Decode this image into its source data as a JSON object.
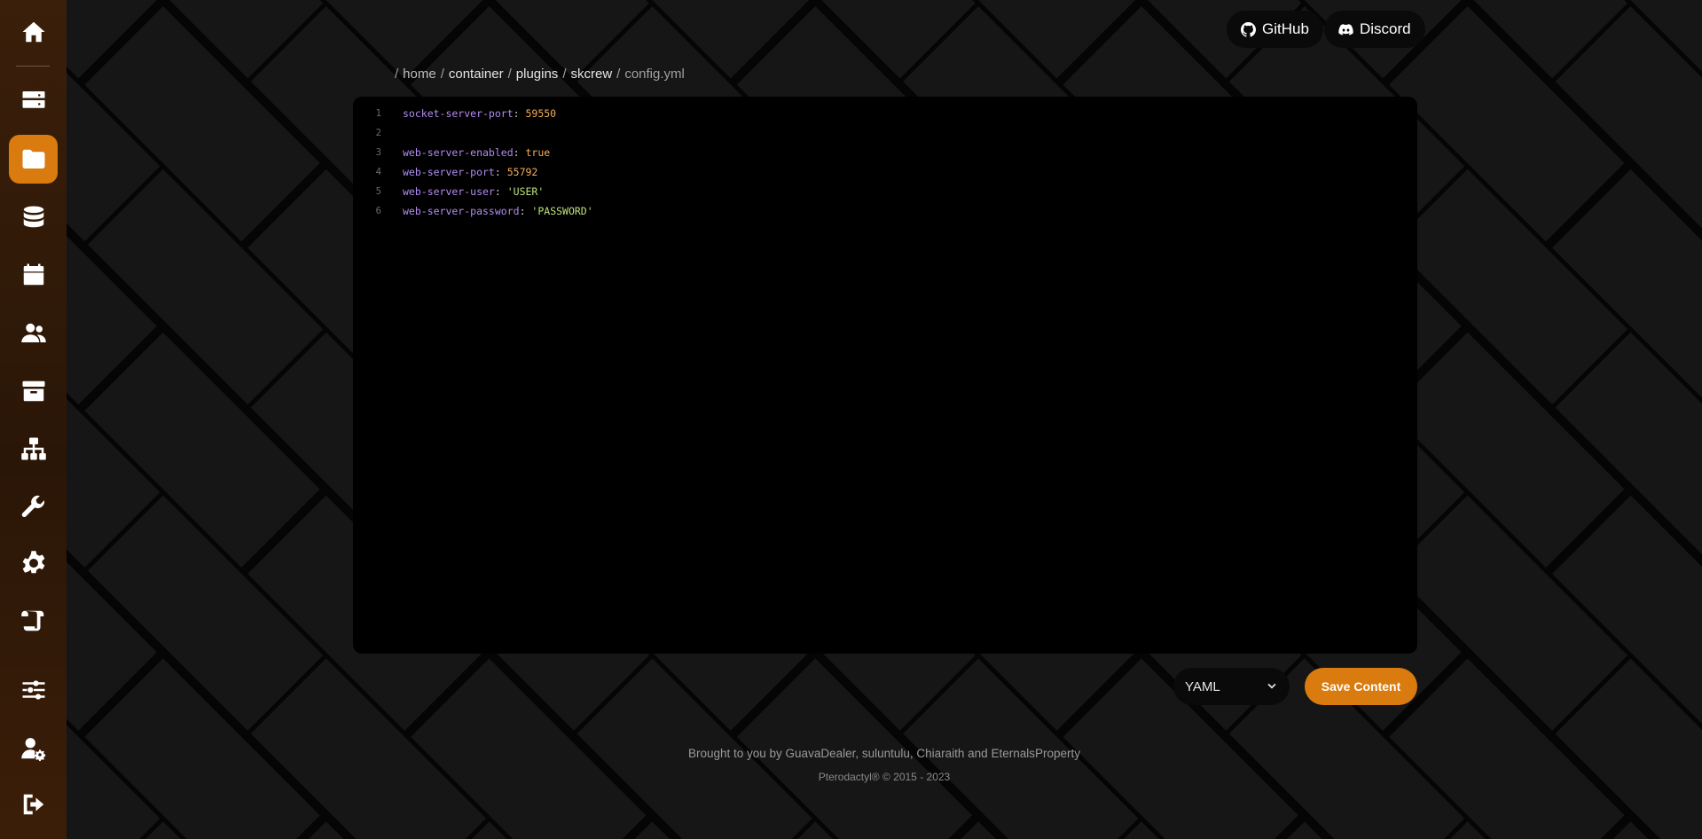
{
  "top_links": {
    "github_label": "GitHub",
    "discord_label": "Discord"
  },
  "breadcrumb": {
    "root_sep": "/",
    "parts": [
      "home",
      "container",
      "plugins",
      "skcrew"
    ],
    "current": "config.yml"
  },
  "editor": {
    "lines": [
      {
        "num": "1",
        "key": "socket-server-port",
        "value": "59550",
        "type": "number"
      },
      {
        "num": "2",
        "key": "",
        "value": "",
        "type": "empty"
      },
      {
        "num": "3",
        "key": "web-server-enabled",
        "value": "true",
        "type": "bool"
      },
      {
        "num": "4",
        "key": "web-server-port",
        "value": "55792",
        "type": "number"
      },
      {
        "num": "5",
        "key": "web-server-user",
        "value": "'USER'",
        "type": "string"
      },
      {
        "num": "6",
        "key": "web-server-password",
        "value": "'PASSWORD'",
        "type": "string"
      }
    ]
  },
  "controls": {
    "language_selected": "YAML",
    "save_label": "Save Content"
  },
  "footer": {
    "credits": "Brought to you by GuavaDealer, suluntulu, Chiaraith and EternalsProperty",
    "copyright": "Pterodactyl® © 2015 - 2023"
  },
  "colors": {
    "accent": "#d97b0e",
    "sidebar": "#2a1607",
    "background": "#161616",
    "editor_bg": "#000000"
  },
  "sidebar": {
    "items": [
      {
        "icon": "home-icon"
      },
      {
        "icon": "server-icon"
      },
      {
        "icon": "folder-icon",
        "active": true
      },
      {
        "icon": "database-icon"
      },
      {
        "icon": "calendar-icon"
      },
      {
        "icon": "users-icon"
      },
      {
        "icon": "archive-icon"
      },
      {
        "icon": "network-icon"
      },
      {
        "icon": "wrench-icon"
      },
      {
        "icon": "gear-icon"
      },
      {
        "icon": "scroll-icon"
      },
      {
        "icon": "sliders-icon"
      },
      {
        "icon": "user-gear-icon"
      },
      {
        "icon": "logout-icon"
      }
    ]
  }
}
